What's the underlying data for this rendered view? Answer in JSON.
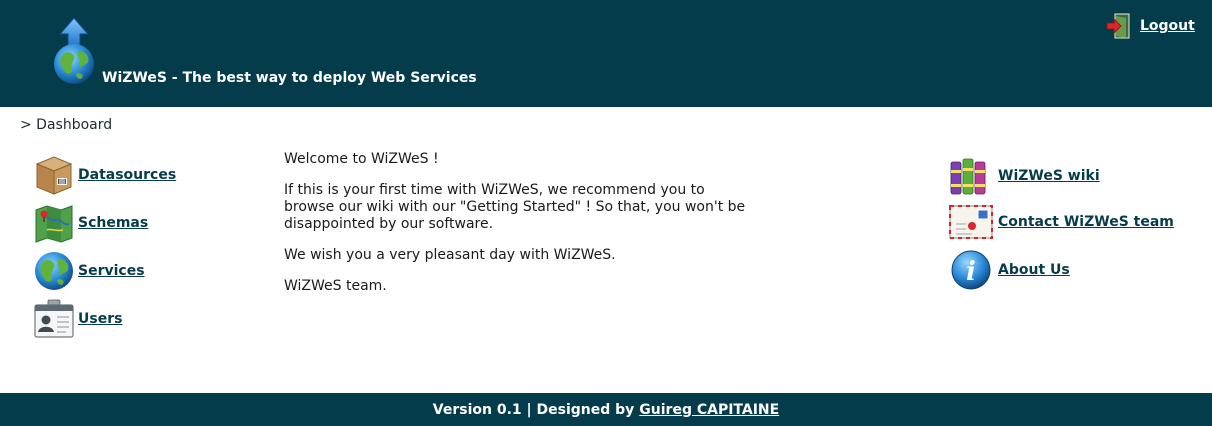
{
  "header": {
    "title": "WiZWeS - The best way to deploy Web Services",
    "logout_label": "Logout",
    "logo_icon": "globe-upload-icon",
    "logout_icon": "exit-door-icon"
  },
  "breadcrumb": "> Dashboard",
  "sidebar": {
    "items": [
      {
        "label": "Datasources",
        "icon": "box-icon"
      },
      {
        "label": "Schemas",
        "icon": "map-icon"
      },
      {
        "label": "Services",
        "icon": "globe-icon"
      },
      {
        "label": "Users",
        "icon": "id-badge-icon"
      }
    ]
  },
  "welcome": {
    "greeting": "Welcome to WiZWeS !",
    "intro": "If this is your first time with WiZWeS, we recommend you to browse our wiki with our \"Getting Started\" ! So that, you won't be disappointed by our software.",
    "wish": "We wish you a very pleasant day with WiZWeS.",
    "signature": "WiZWeS team."
  },
  "links": {
    "items": [
      {
        "label": "WiZWeS wiki",
        "icon": "books-icon"
      },
      {
        "label": "Contact WiZWeS team",
        "icon": "envelope-icon"
      },
      {
        "label": "About Us",
        "icon": "info-icon"
      }
    ]
  },
  "footer": {
    "prefix": "Version 0.1 | Designed by",
    "author": "Guireg CAPITAINE"
  },
  "colors": {
    "header_bg": "#053c4b",
    "link": "#053c4b"
  }
}
